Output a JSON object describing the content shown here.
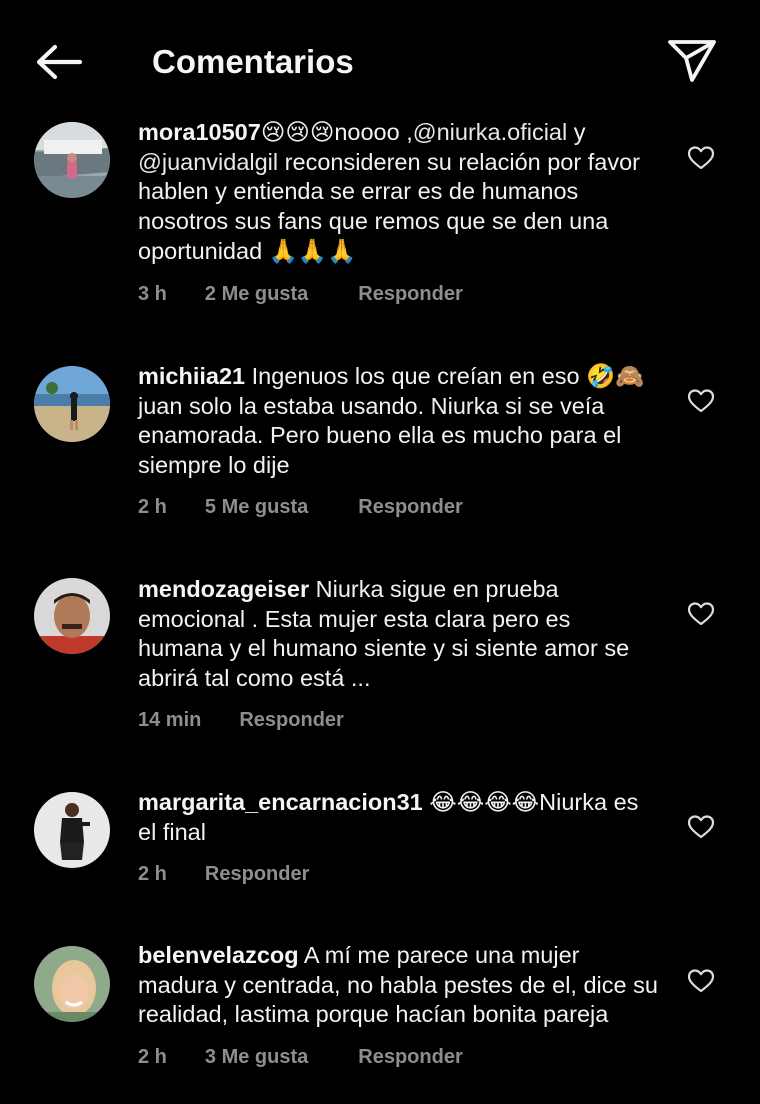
{
  "header": {
    "title": "Comentarios",
    "back_icon": "arrow-left-icon",
    "share_icon": "paper-plane-icon"
  },
  "comments": [
    {
      "username": "mora10507",
      "text_parts": [
        "😢😢😢noooo ,",
        "@niurka.oficial",
        " y ",
        "@juanvidalgil",
        "  reconsideren su relación por favor hablen y entienda se errar es de humanos nosotros sus fans que remos que se den una oportunidad 🙏🙏🙏"
      ],
      "time": "3 h",
      "likes": "2 Me gusta",
      "reply": "Responder"
    },
    {
      "username": "michiia21",
      "text": " Ingenuos los que creían en eso 🤣🙈 juan solo la estaba usando. Niurka si se veía enamorada. Pero bueno ella es mucho para el siempre lo dije",
      "time": "2 h",
      "likes": "5 Me gusta",
      "reply": "Responder"
    },
    {
      "username": "mendozageiser",
      "text": " Niurka sigue en prueba emocional . Esta mujer esta clara pero es humana y el humano siente y si siente amor se abrirá tal como está ...",
      "time": "14 min",
      "reply": "Responder"
    },
    {
      "username": "margarita_encarnacion31",
      "text": " 😂😂😂😂Niurka es el final",
      "time": "2 h",
      "reply": "Responder"
    },
    {
      "username": "belenvelazcog",
      "text": " A mí me parece una mujer madura y centrada, no habla pestes de el, dice su realidad, lastima porque hacían bonita pareja",
      "time": "2 h",
      "likes": "3 Me gusta",
      "reply": "Responder"
    }
  ],
  "colors": {
    "background": "#000000",
    "text": "#f5f5f5",
    "meta": "#8e8e8e"
  }
}
